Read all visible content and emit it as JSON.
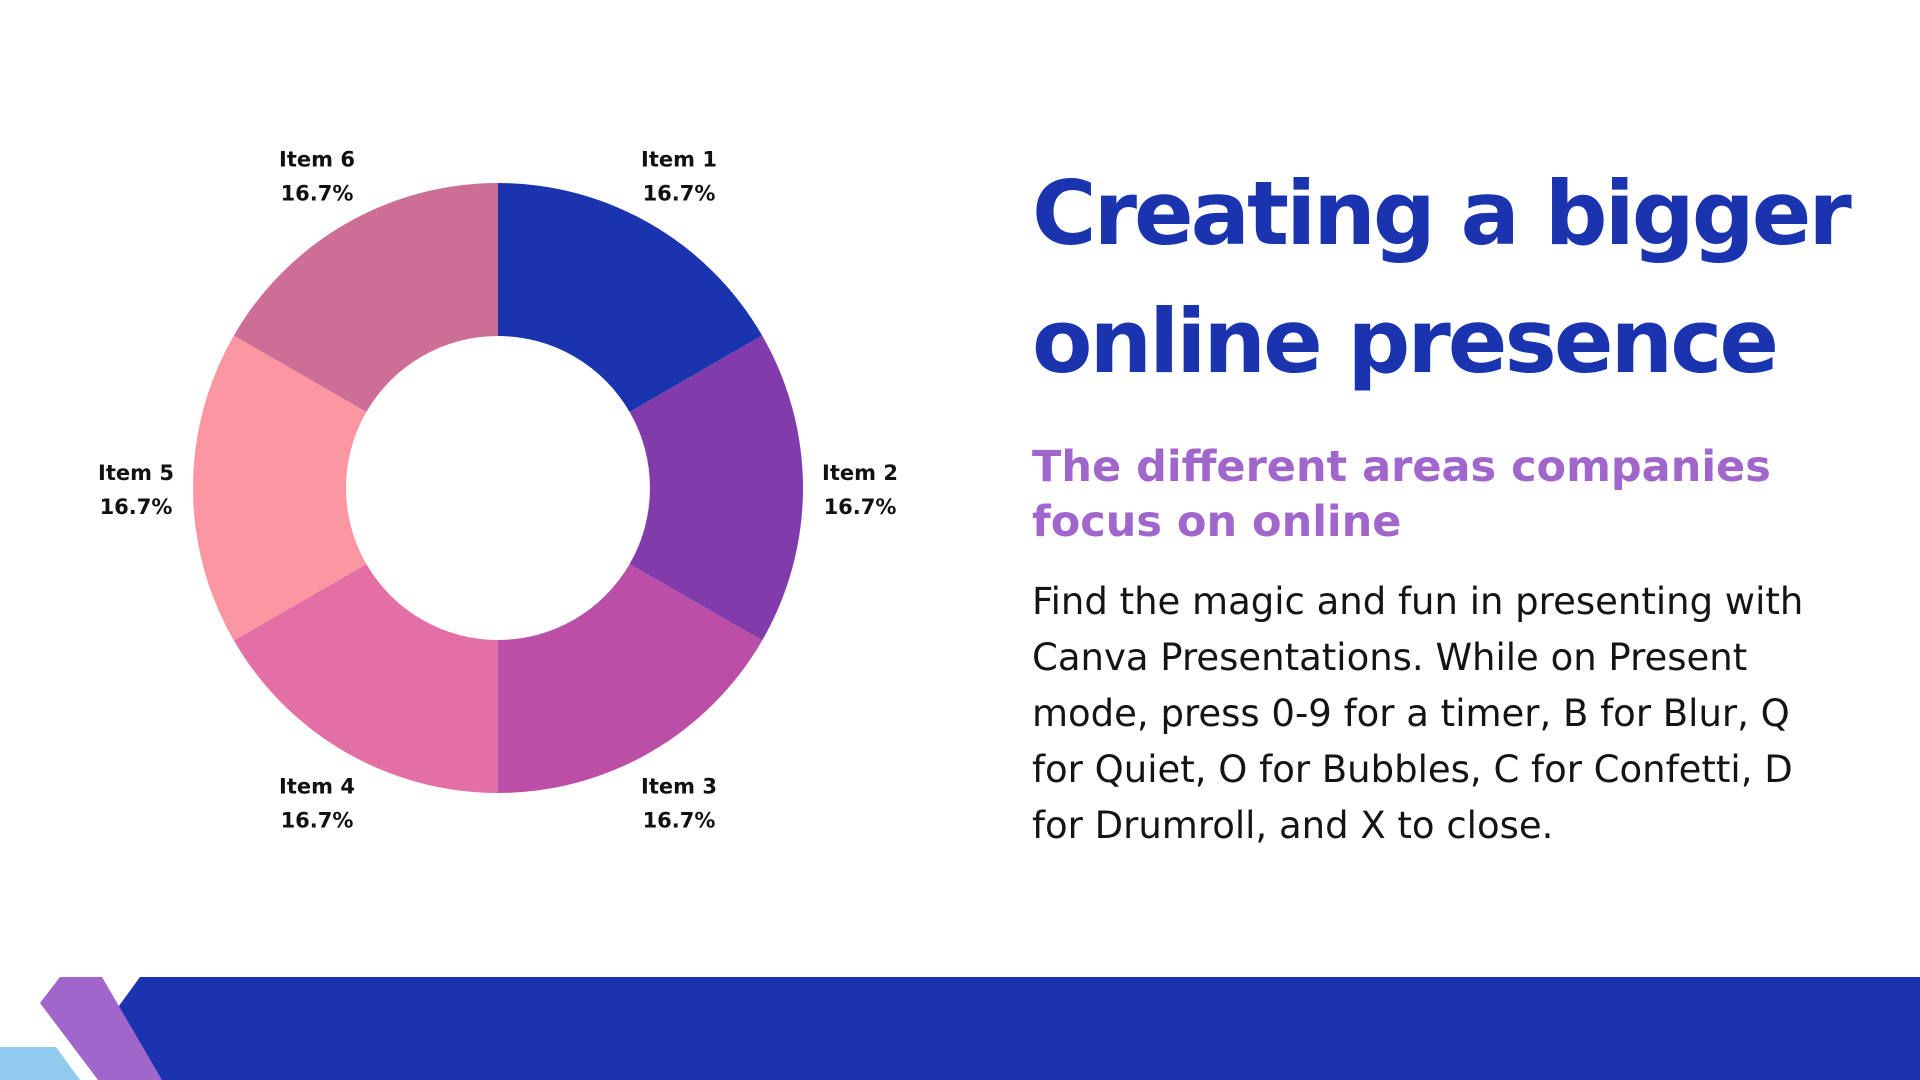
{
  "slide": {
    "title": "Creating a bigger online presence",
    "subtitle": "The different areas companies focus on online",
    "body": "Find the magic and fun in presenting with Canva Presentations. While on Present mode, press 0-9 for a timer, B for Blur, Q for Quiet, O for Bubbles, C for Confetti, D for Drumroll, and X to close."
  },
  "colors": {
    "title": "#1a34b0",
    "subtitle": "#a066cb",
    "body": "#141414",
    "footer_band": "#1a34b0",
    "footer_stripe": "#a066cb",
    "footer_corner": "#8ecbec"
  },
  "chart_data": {
    "type": "pie",
    "style": "donut",
    "categories": [
      "Item 1",
      "Item 2",
      "Item 3",
      "Item 4",
      "Item 5",
      "Item 6"
    ],
    "values": [
      16.7,
      16.7,
      16.7,
      16.7,
      16.7,
      16.7
    ],
    "value_labels": [
      "16.7%",
      "16.7%",
      "16.7%",
      "16.7%",
      "16.7%",
      "16.7%"
    ],
    "colors": [
      "#1a34b0",
      "#823bab",
      "#bb4ea6",
      "#e46fa4",
      "#fd96a3",
      "#cc6e96"
    ],
    "start_angle_deg": 0,
    "direction": "clockwise",
    "legend": "none"
  }
}
